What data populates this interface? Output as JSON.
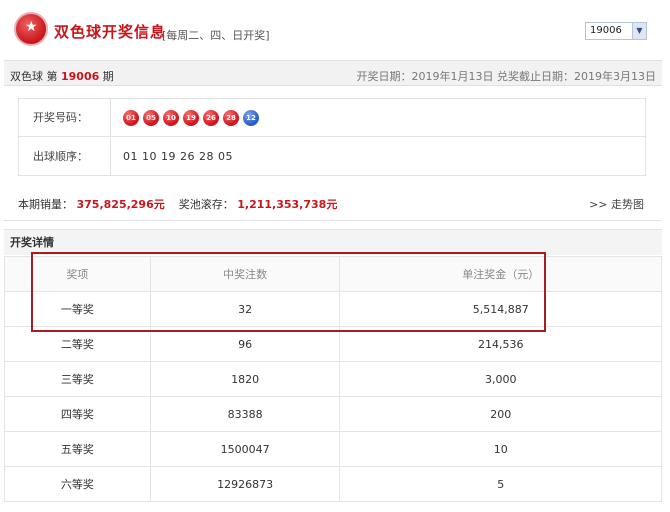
{
  "header": {
    "title": "双色球开奖信息",
    "draw_days": "[每周二、四、日开奖]",
    "issue_select": "19006"
  },
  "info_bar": {
    "issue_prefix": "双色球 第",
    "issue_number": "19006",
    "issue_suffix": "期",
    "draw_date": "开奖日期：2019年1月13日",
    "deadline": "兑奖截止日期：2019年3月13日"
  },
  "numbers": {
    "winning_label": "开奖号码：",
    "red_balls": [
      "01",
      "05",
      "10",
      "19",
      "26",
      "28"
    ],
    "blue_ball": "12",
    "order_label": "出球顺序：",
    "order": "01 10 19 26 28 05"
  },
  "sales": {
    "sales_label": "本期销量：",
    "sales_value": "375,825,296元",
    "pool_label": "奖池滚存：",
    "pool_value": "1,211,353,738元",
    "trend_link": ">> 走势图"
  },
  "details": {
    "title": "开奖详情",
    "columns": [
      "奖项",
      "中奖注数",
      "单注奖金（元）"
    ],
    "rows": [
      [
        "一等奖",
        "32",
        "5,514,887"
      ],
      [
        "二等奖",
        "96",
        "214,536"
      ],
      [
        "三等奖",
        "1820",
        "3,000"
      ],
      [
        "四等奖",
        "83388",
        "200"
      ],
      [
        "五等奖",
        "1500047",
        "10"
      ],
      [
        "六等奖",
        "12926873",
        "5"
      ]
    ]
  },
  "colors": {
    "accent_red": "#c8161d",
    "highlight_border": "#a51e22",
    "blue_ball": "#2a5bc9"
  }
}
